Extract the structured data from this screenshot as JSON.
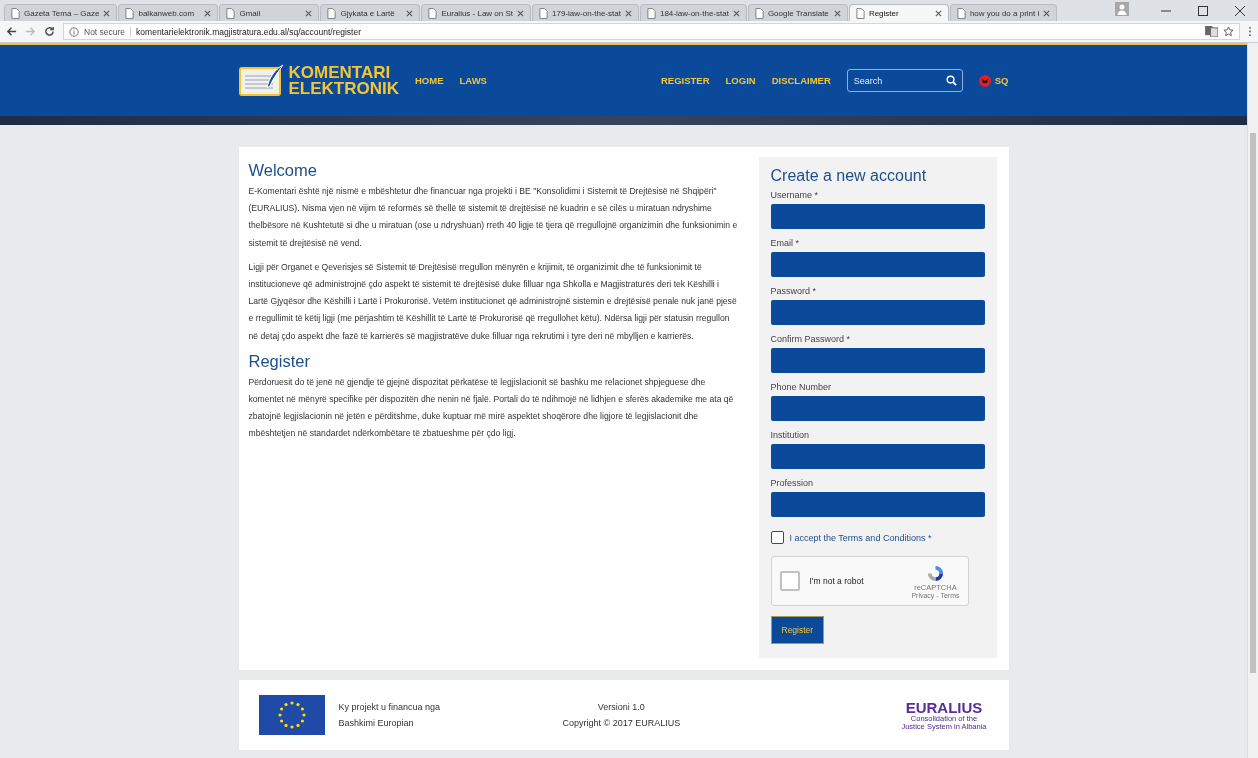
{
  "browser": {
    "tabs": [
      {
        "title": "Gazeta Tema – Gaze",
        "selected": false
      },
      {
        "title": "balkanweb.com",
        "selected": false
      },
      {
        "title": "Gmail",
        "selected": false
      },
      {
        "title": "Gjykata e Lartë",
        "selected": false
      },
      {
        "title": "Euralius - Law on St",
        "selected": false
      },
      {
        "title": "179-law-on-the-stat",
        "selected": false
      },
      {
        "title": "184-law-on-the-stat",
        "selected": false
      },
      {
        "title": "Google Translate",
        "selected": false
      },
      {
        "title": "Register",
        "selected": true
      },
      {
        "title": "how you do a print i",
        "selected": false
      }
    ],
    "security": "Not secure",
    "url": "komentarielektronik.magjistratura.edu.al/sq/account/register"
  },
  "site": {
    "logo": [
      "KOMENTARI",
      "ELEKTRONIK"
    ],
    "nav_left": [
      "HOME",
      "LAWS"
    ],
    "nav_right": [
      "REGISTER",
      "LOGIN",
      "DISCLAIMER"
    ],
    "search": {
      "placeholder": "Search"
    },
    "language": "SQ"
  },
  "content": {
    "sections": [
      {
        "heading": "Welcome",
        "paragraphs": [
          "E-Komentari është një nismë e mbështetur dhe financuar nga projekti i BE \"Konsolidimi i Sistemit të Drejtësisë në Shqipëri\" (EURALIUS). Nisma vjen në vijim të reformës së thellë të sistemit të drejtësisë në kuadrin e së cilës u miratuan ndryshime thelbësore në Kushtetutë si dhe u miratuan (ose u ndryshuan) rreth 40 ligje të tjera që rregullojnë organizimin dhe funksionimin e sistemit të drejtësisë në vend.",
          "Ligji për Organet e Qeverisjes së Sistemit të Drejtësisë rregullon mënyrën e krijimit, të organizimit dhe të funksionimit të institucioneve që administrojnë çdo aspekt të sistemit të drejtësisë duke filluar nga Shkolla e Magjistraturës deri tek Këshilli i Lartë Gjyqësor dhe Këshilli i Lartë i Prokurorisë. Vetëm institucionet që administrojnë sistemin e drejtësisë penale nuk janë pjesë e rregullimit të këtij ligji (me përjashtim të Këshillit të Lartë të Prokurorisë që rregullohet këtu). Ndërsa ligji për statusin rregullon në detaj çdo aspekt dhe fazë të karrierës së magjistratëve duke filluar nga rekrutimi i tyre deri në mbylljen e karrierës."
        ]
      },
      {
        "heading": "Register",
        "paragraphs": [
          "Përdoruesit do të jenë në gjendje të gjejnë dispozitat përkatëse të legjislacionit së bashku me relacionet shpjeguese dhe komentet në mënyrë specifike për dispozitën dhe nenin në fjalë. Portali do të ndihmojë në lidhjen e sferës akademike me ata që zbatojnë legjislacionin në jetën e përditshme, duke kuptuar më mirë aspektet shoqërore dhe ligjore të legjislacionit dhe mbështetjen në standardet ndërkombëtare të zbatueshme për çdo ligj."
        ]
      }
    ]
  },
  "form": {
    "title": "Create a new account",
    "fields": [
      {
        "label": "Username *"
      },
      {
        "label": "Email *"
      },
      {
        "label": "Password *"
      },
      {
        "label": "Confirm Password *"
      },
      {
        "label": "Phone Number"
      },
      {
        "label": "Institution"
      },
      {
        "label": "Profession"
      }
    ],
    "terms": {
      "label": "I accept the Terms and Conditions *",
      "checked": false
    },
    "captcha": {
      "label": "I'm not a robot",
      "checked": false,
      "brand": "reCAPTCHA",
      "links": "Privacy - Terms"
    },
    "submit": "Register"
  },
  "footer": {
    "funding": [
      "Ky projekt u financua nga",
      "Bashkimi Europian"
    ],
    "version": "Versioni 1.0",
    "copyright": "Copyright © 2017 EURALIUS",
    "partner": {
      "name": "EURALIUS",
      "tagline": [
        "Consolidation of the",
        "Justice System in Albania"
      ]
    }
  }
}
